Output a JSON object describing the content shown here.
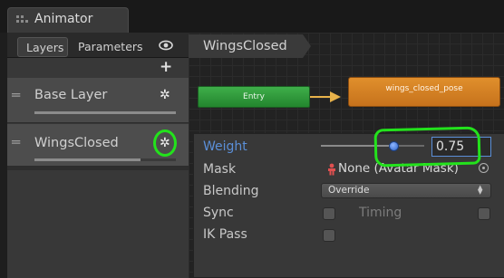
{
  "window": {
    "tab_title": "Animator"
  },
  "left_panel": {
    "tabs": [
      {
        "label": "Layers"
      },
      {
        "label": "Parameters"
      }
    ],
    "layers": [
      {
        "name": "Base Layer",
        "weight": 1.0
      },
      {
        "name": "WingsClosed",
        "weight": 0.75
      }
    ]
  },
  "graph": {
    "breadcrumb": "WingsClosed",
    "states": [
      {
        "label": "Entry",
        "color": "#2f9e3c"
      },
      {
        "label": "wings_closed_pose",
        "color": "#d9822b"
      }
    ]
  },
  "layer_settings": {
    "weight": {
      "label": "Weight",
      "value": "0.75",
      "slider_fraction": 0.75
    },
    "mask": {
      "label": "Mask",
      "value": "None (Avatar Mask)"
    },
    "blending": {
      "label": "Blending",
      "value": "Override"
    },
    "sync": {
      "label": "Sync",
      "checked": false,
      "timing_label": "Timing",
      "timing_checked": false
    },
    "ik_pass": {
      "label": "IK Pass",
      "checked": false
    }
  },
  "colors": {
    "annotation": "#23e21c",
    "accent": "#5b8fd8"
  },
  "icons": [
    "animator-icon",
    "eye-icon",
    "plus-icon",
    "drag-handle-icon",
    "gear-icon",
    "avatar-mask-icon",
    "object-picker-icon",
    "dropdown-caret-icon"
  ]
}
